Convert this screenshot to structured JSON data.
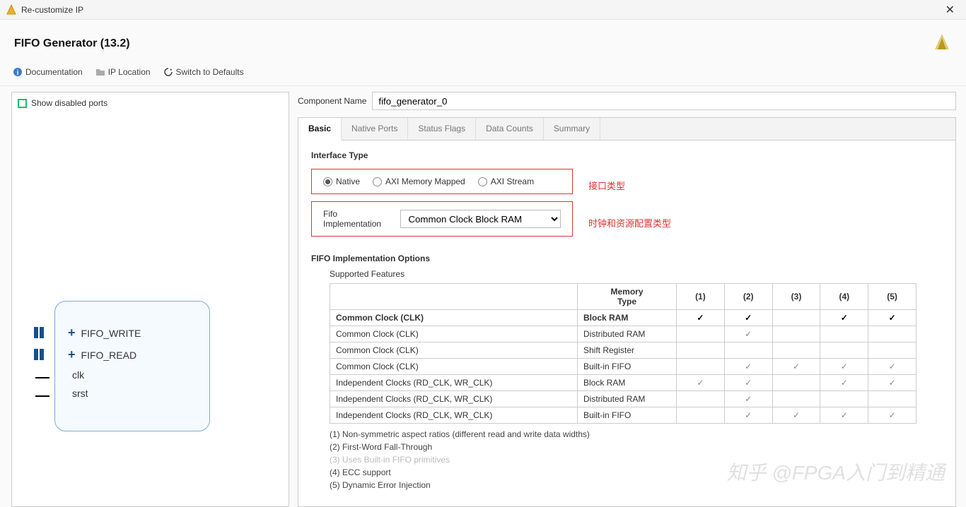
{
  "window": {
    "title": "Re-customize IP"
  },
  "header": {
    "title": "FIFO Generator (13.2)"
  },
  "toolbar": {
    "doc": "Documentation",
    "iploc": "IP Location",
    "defaults": "Switch to Defaults"
  },
  "left": {
    "show_disabled": "Show disabled ports",
    "ports": {
      "p1": "FIFO_WRITE",
      "p2": "FIFO_READ",
      "p3": "clk",
      "p4": "srst"
    }
  },
  "comp": {
    "label": "Component Name",
    "value": "fifo_generator_0"
  },
  "tabs": [
    "Basic",
    "Native Ports",
    "Status Flags",
    "Data Counts",
    "Summary"
  ],
  "basic": {
    "iface_title": "Interface Type",
    "radios": {
      "r1": "Native",
      "r2": "AXI Memory Mapped",
      "r3": "AXI Stream"
    },
    "annot1": "接口类型",
    "impl_label": "Fifo Implementation",
    "impl_value": "Common Clock Block RAM",
    "annot2": "时钟和资源配置类型",
    "opts_title": "FIFO Implementation Options",
    "features_label": "Supported Features",
    "th_mem": "Memory\nType",
    "cols": [
      "(1)",
      "(2)",
      "(3)",
      "(4)",
      "(5)"
    ],
    "rows": [
      {
        "name": "Common Clock (CLK)",
        "mem": "Block RAM",
        "c": [
          "✓b",
          "✓b",
          "",
          "✓b",
          "✓b"
        ],
        "bold": true
      },
      {
        "name": "Common Clock (CLK)",
        "mem": "Distributed RAM",
        "c": [
          "",
          "✓",
          "",
          "",
          ""
        ]
      },
      {
        "name": "Common Clock (CLK)",
        "mem": "Shift Register",
        "c": [
          "",
          "",
          "",
          "",
          ""
        ]
      },
      {
        "name": "Common Clock (CLK)",
        "mem": "Built-in FIFO",
        "c": [
          "",
          "✓",
          "✓",
          "✓",
          "✓"
        ]
      },
      {
        "name": "Independent Clocks (RD_CLK, WR_CLK)",
        "mem": "Block RAM",
        "c": [
          "✓",
          "✓",
          "",
          "✓",
          "✓"
        ]
      },
      {
        "name": "Independent Clocks (RD_CLK, WR_CLK)",
        "mem": "Distributed RAM",
        "c": [
          "",
          "✓",
          "",
          "",
          ""
        ]
      },
      {
        "name": "Independent Clocks (RD_CLK, WR_CLK)",
        "mem": "Built-in FIFO",
        "c": [
          "",
          "✓",
          "✓",
          "✓",
          "✓"
        ]
      }
    ],
    "notes": [
      {
        "t": "(1) Non-symmetric aspect ratios (different read and write data widths)"
      },
      {
        "t": "(2) First-Word Fall-Through"
      },
      {
        "t": "(3) Uses Built-in FIFO primitives",
        "dim": true
      },
      {
        "t": "(4) ECC support"
      },
      {
        "t": "(5) Dynamic Error Injection"
      }
    ]
  },
  "watermark": "知乎 @FPGA入门到精通"
}
